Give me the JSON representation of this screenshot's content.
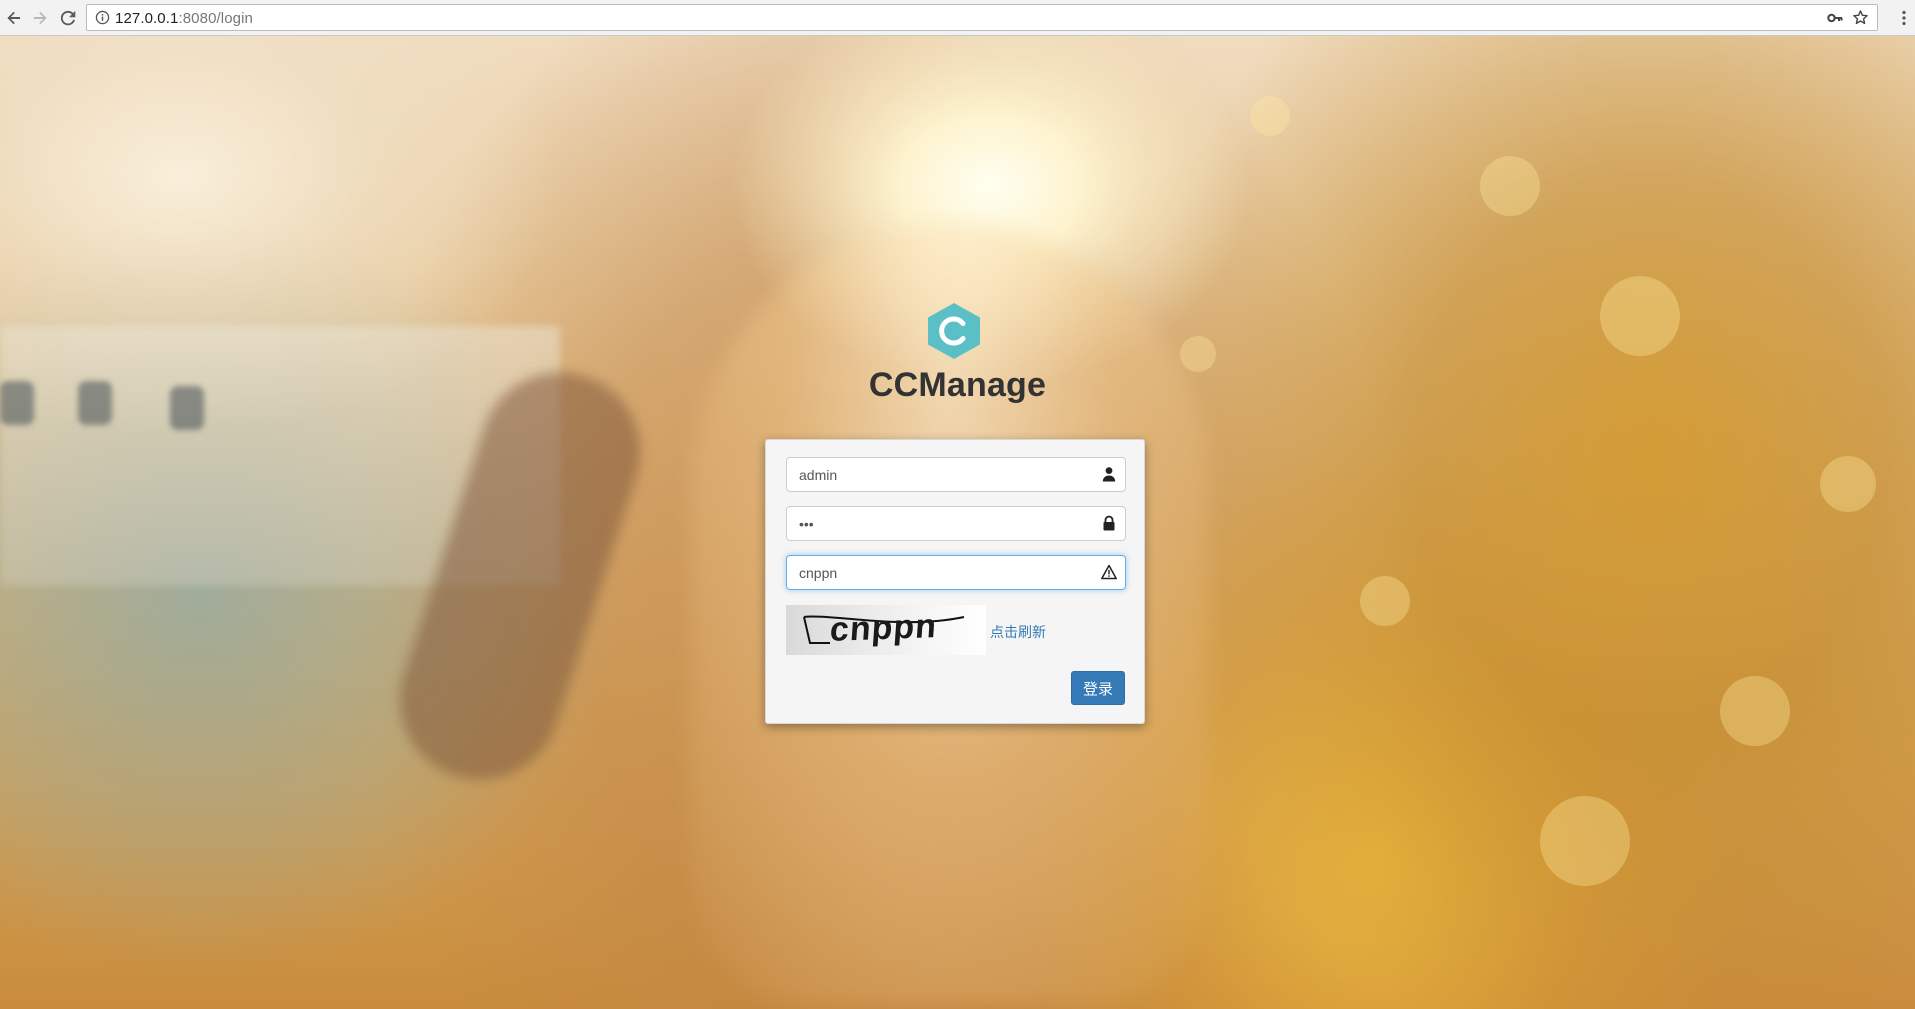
{
  "browser": {
    "url_host": "127.0.0.1",
    "url_path": ":8080/login",
    "icons": {
      "back": "back-arrow-icon",
      "forward": "forward-arrow-icon",
      "reload": "reload-icon",
      "info": "info-icon",
      "key": "key-icon",
      "bookmark": "star-icon",
      "menu": "kebab-menu-icon"
    }
  },
  "brand": {
    "logo_icon": "hexagon-c-logo",
    "logo_color": "#5bc0c6",
    "title": "CCManage"
  },
  "login_form": {
    "username": {
      "value": "admin",
      "icon": "user-icon"
    },
    "password": {
      "value": "•••",
      "icon": "lock-icon"
    },
    "captcha": {
      "value": "cnppn",
      "icon": "warning-triangle-icon",
      "image_text": "cnppn"
    },
    "refresh_label": "点击刷新",
    "submit_label": "登录",
    "colors": {
      "primary": "#337ab7",
      "focus_border": "#66afe9"
    }
  }
}
